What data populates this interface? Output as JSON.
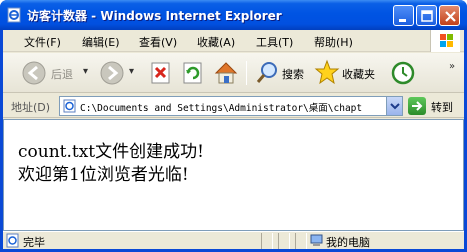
{
  "window": {
    "title": "访客计数器 - Windows Internet Explorer"
  },
  "menu": {
    "items": [
      "文件(F)",
      "编辑(E)",
      "查看(V)",
      "收藏(A)",
      "工具(T)",
      "帮助(H)"
    ]
  },
  "toolbar": {
    "back_label": "后退",
    "search_label": "搜索",
    "favorites_label": "收藏夹"
  },
  "address": {
    "label": "地址(D)",
    "value": "C:\\Documents and Settings\\Administrator\\桌面\\chapt",
    "go_label": "转到"
  },
  "page": {
    "line1": "count.txt文件创建成功!",
    "line2": "欢迎第1位浏览者光临!"
  },
  "status": {
    "text": "完毕",
    "zone": "我的电脑"
  },
  "colors": {
    "titlebar": "#0054e3",
    "frame": "#ece9d8",
    "close_button": "#c2401a"
  }
}
